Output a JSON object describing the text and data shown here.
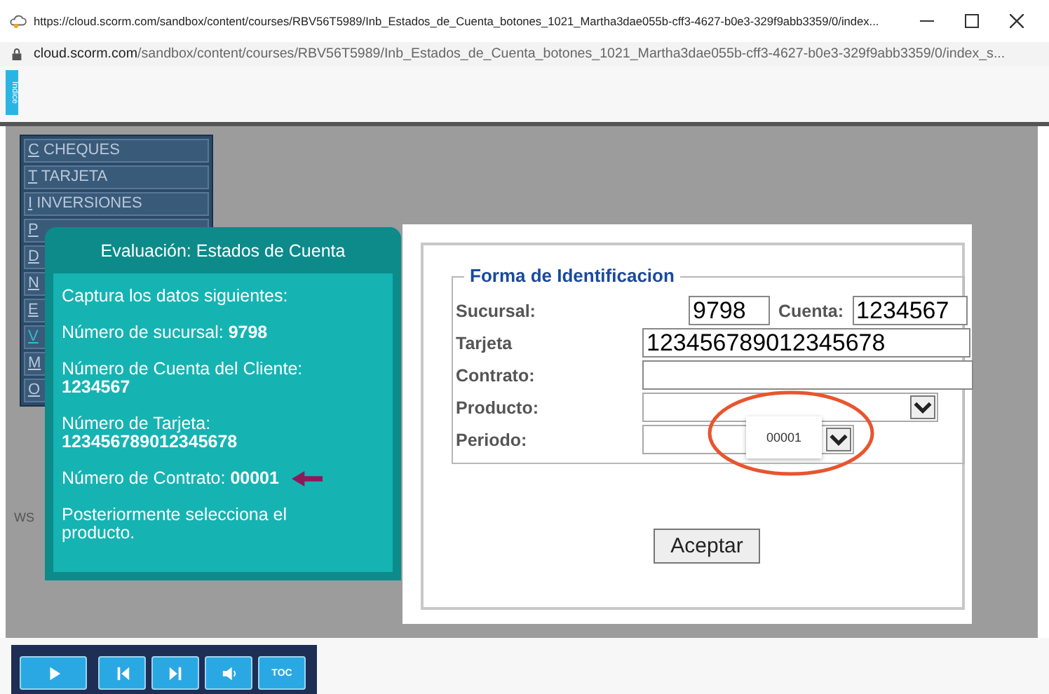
{
  "window": {
    "url": "https://cloud.scorm.com/sandbox/content/courses/RBV56T5989/Inb_Estados_de_Cuenta_botones_1021_Martha3dae055b-cff3-4627-b0e3-329f9abb3359/0/index..."
  },
  "address_bar": {
    "host": "cloud.scorm.com",
    "path": "/sandbox/content/courses/RBV56T5989/Inb_Estados_de_Cuenta_botones_1021_Martha3dae055b-cff3-4627-b0e3-329f9abb3359/0/index_s..."
  },
  "index_tab": {
    "label": "Indice"
  },
  "menu": [
    {
      "key": "C",
      "label": "CHEQUES",
      "selected": false
    },
    {
      "key": "T",
      "label": "TARJETA",
      "selected": false
    },
    {
      "key": "I",
      "label": "INVERSIONES",
      "selected": false
    },
    {
      "key": "P",
      "selected": false
    },
    {
      "key": "D",
      "selected": false
    },
    {
      "key": "N",
      "selected": false
    },
    {
      "key": "E",
      "selected": false
    },
    {
      "key": "V",
      "selected": true
    },
    {
      "key": "M",
      "selected": false
    },
    {
      "key": "O",
      "selected": false
    }
  ],
  "stage_note": "WS",
  "instructions": {
    "title": "Evaluación: Estados de Cuenta",
    "lines": [
      {
        "text": "Captura los datos siguientes:",
        "arrow": false
      },
      {
        "text": "Número de sucursal: **9798**",
        "arrow": false
      },
      {
        "text": "Número de Cuenta del Cliente: **1234567**",
        "arrow": false
      },
      {
        "text": "Número de Tarjeta: **123456789012345678**",
        "arrow": false
      },
      {
        "text": "Número de Contrato: **00001**",
        "arrow": true
      },
      {
        "text": "Posteriormente selecciona el producto.",
        "arrow": false
      }
    ]
  },
  "form": {
    "legend": "Forma de Identificacion",
    "sucursal": {
      "label": "Sucursal:",
      "value": "9798"
    },
    "cuenta": {
      "label": "Cuenta:",
      "value": "1234567"
    },
    "tarjeta": {
      "label": "Tarjeta",
      "value": "123456789012345678"
    },
    "contrato": {
      "label": "Contrato:"
    },
    "producto": {
      "label": "Producto:"
    },
    "periodo": {
      "label": "Periodo:"
    },
    "tooltip": "00001",
    "button": "Aceptar"
  },
  "player": [
    {
      "kind": "play"
    },
    {
      "kind": "prev"
    },
    {
      "kind": "next"
    },
    {
      "kind": "volume"
    },
    {
      "kind": "toc",
      "label": "TOC"
    }
  ]
}
